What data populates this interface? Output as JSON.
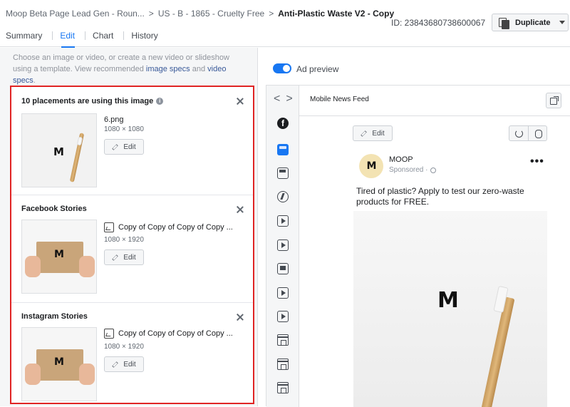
{
  "header": {
    "breadcrumb": [
      "Moop Beta Page Lead Gen - Roun...",
      "US - B - 1865 - Cruelty Free",
      "Anti-Plastic Waste V2 - Copy"
    ],
    "breadcrumb_separator": ">",
    "tabs": [
      "Summary",
      "Edit",
      "Chart",
      "History"
    ],
    "active_tab": "Edit",
    "ad_id": "ID: 23843680738600067",
    "duplicate_label": "Duplicate",
    "duplicate_icon": "copy-icon"
  },
  "left_panel": {
    "description_prefix": "Choose an image or video, or create a new video or slideshow using a template. View recommended",
    "link_image_specs": "image specs",
    "description_and": "and",
    "link_video_specs": "video specs",
    "description_suffix": ".",
    "sections": [
      {
        "title": "10 placements are using this image",
        "info_icon": "i",
        "file_name": "6.png",
        "dimensions": "1080 × 1080",
        "edit_label": "Edit"
      },
      {
        "title": "Facebook Stories",
        "file_name": "Copy of Copy of Copy of Copy ...",
        "dimensions": "1080 × 1920",
        "edit_label": "Edit"
      },
      {
        "title": "Instagram Stories",
        "file_name": "Copy of Copy of Copy of Copy ...",
        "dimensions": "1080 × 1920",
        "edit_label": "Edit"
      }
    ]
  },
  "right_panel": {
    "ad_preview_label": "Ad preview",
    "ad_preview_enabled": true,
    "nav_prev": "<",
    "nav_next": ">",
    "placement_label": "Mobile News Feed",
    "edit_label": "Edit",
    "post": {
      "page_name": "MOOP",
      "sponsored": "Sponsored · ",
      "more": "•••",
      "text": "Tired of plastic? Apply to test our zero-waste products for FREE.",
      "logo_text": "M"
    },
    "placement_icons": [
      "facebook-icon",
      "news-feed-icon",
      "marketplace-icon",
      "instant-articles-icon",
      "video-feeds-icon",
      "in-stream-video-icon",
      "stories-icon",
      "video-icon",
      "video-icon",
      "shop-icon",
      "shop-icon",
      "shop-icon"
    ]
  },
  "colors": {
    "accent": "#1877f2",
    "highlight_border": "#e02424",
    "panel_bg": "#f5f6f7"
  }
}
